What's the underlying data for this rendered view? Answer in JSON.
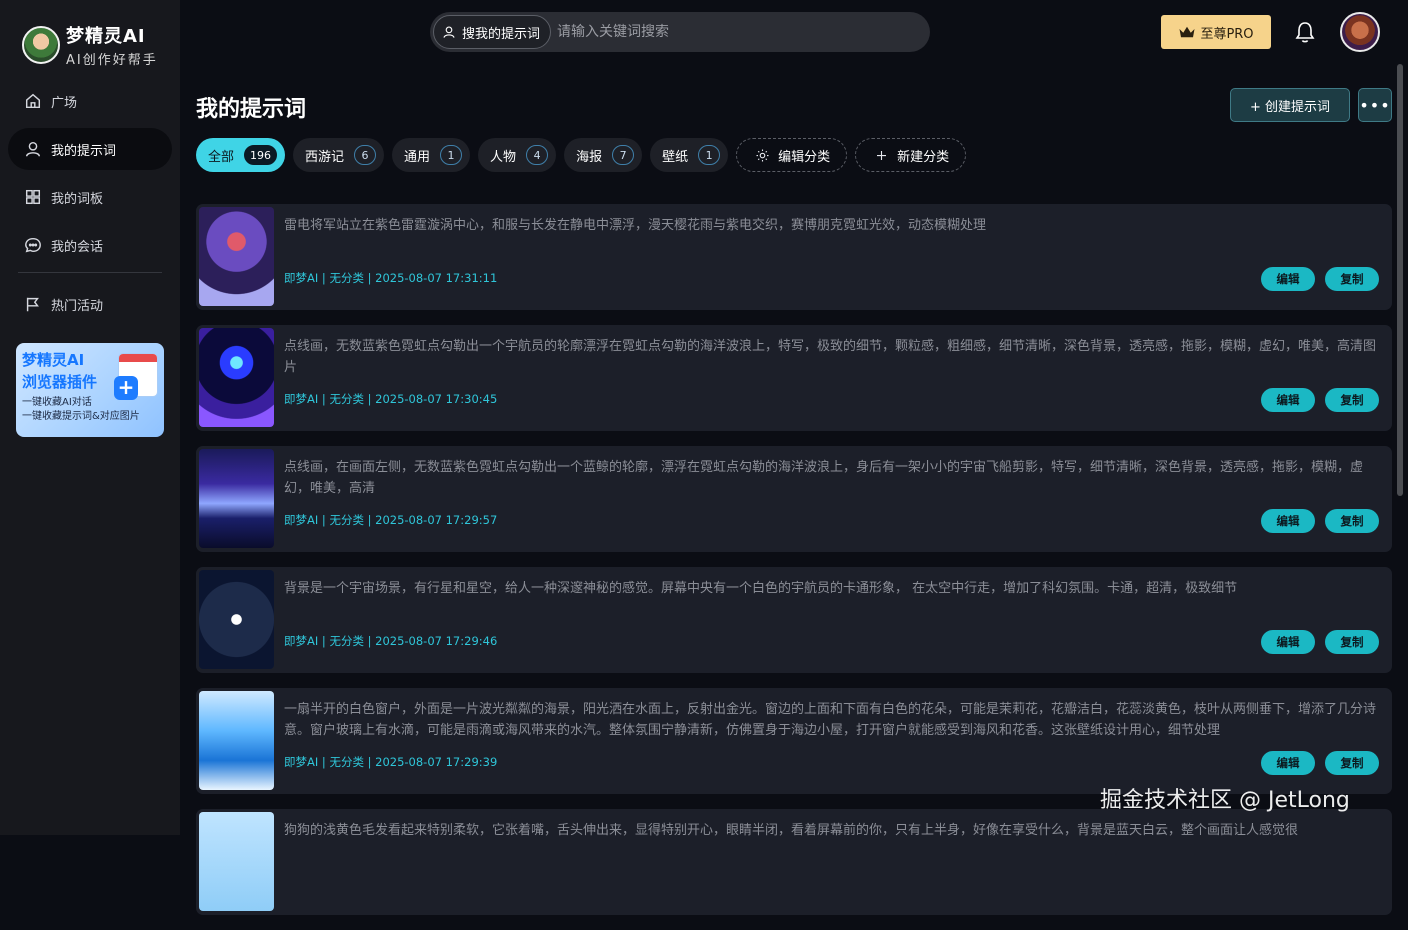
{
  "app": {
    "title": "梦精灵AI",
    "subtitle": "AI创作好帮手"
  },
  "sidebar": {
    "items": [
      {
        "label": "广场",
        "icon": "home-icon",
        "active": false
      },
      {
        "label": "我的提示词",
        "icon": "user-icon",
        "active": true
      },
      {
        "label": "我的词板",
        "icon": "grid-icon",
        "active": false
      },
      {
        "label": "我的会话",
        "icon": "chat-icon",
        "active": false
      },
      {
        "label": "热门活动",
        "icon": "flag-icon",
        "active": false
      }
    ],
    "promo": {
      "title1": "梦精灵AI",
      "title2": "浏览器插件",
      "line1": "一键收藏AI对话",
      "line2": "一键收藏提示词&对应图片"
    }
  },
  "search": {
    "scope_label": "搜我的提示词",
    "placeholder": "请输入关键词搜索",
    "value": ""
  },
  "header": {
    "pro_label": "至尊PRO",
    "pro_color": "#f6d38b"
  },
  "page": {
    "title": "我的提示词",
    "create_label": "+ 创建提示词",
    "more_label": "•••"
  },
  "tabs": [
    {
      "label": "全部",
      "count": "196",
      "active": true
    },
    {
      "label": "西游记",
      "count": "6",
      "active": false
    },
    {
      "label": "通用",
      "count": "1",
      "active": false
    },
    {
      "label": "人物",
      "count": "4",
      "active": false
    },
    {
      "label": "海报",
      "count": "7",
      "active": false
    },
    {
      "label": "壁纸",
      "count": "1",
      "active": false
    }
  ],
  "tab_actions": {
    "edit_category": "编辑分类",
    "new_category": "新建分类"
  },
  "card_actions": {
    "edit": "编辑",
    "copy": "复制"
  },
  "prompts": [
    {
      "text": "雷电将军站立在紫色雷霆漩涡中心，和服与长发在静电中漂浮，漫天樱花雨与紫电交织，赛博朋克霓虹光效，动态模糊处理",
      "meta": "即梦AI | 无分类 | 2025-08-07 17:31:11"
    },
    {
      "text": "点线画，无数蓝紫色霓虹点勾勒出一个宇航员的轮廓漂浮在霓虹点勾勒的海洋波浪上，特写，极致的细节，颗粒感，粗细感，细节清晰，深色背景，透亮感，拖影，模糊，虚幻，唯美，高清图片",
      "meta": "即梦AI | 无分类 | 2025-08-07 17:30:45"
    },
    {
      "text": "点线画，在画面左侧，无数蓝紫色霓虹点勾勒出一个蓝鲸的轮廓，漂浮在霓虹点勾勒的海洋波浪上，身后有一架小小的宇宙飞船剪影，特写，细节清晰，深色背景，透亮感，拖影，模糊，虚幻，唯美，高清",
      "meta": "即梦AI | 无分类 | 2025-08-07 17:29:57"
    },
    {
      "text": "背景是一个宇宙场景，有行星和星空，给人一种深邃神秘的感觉。屏幕中央有一个白色的宇航员的卡通形象， 在太空中行走，增加了科幻氛围。卡通，超清，极致细节",
      "meta": "即梦AI | 无分类 | 2025-08-07 17:29:46"
    },
    {
      "text": "一扇半开的白色窗户，外面是一片波光粼粼的海景，阳光洒在水面上，反射出金光。窗边的上面和下面有白色的花朵，可能是茉莉花，花瓣洁白，花蕊淡黄色，枝叶从两侧垂下，增添了几分诗意。窗户玻璃上有水滴，可能是雨滴或海风带来的水汽。整体氛围宁静清新，仿佛置身于海边小屋，打开窗户就能感受到海风和花香。这张壁纸设计用心，细节处理",
      "meta": "即梦AI | 无分类 | 2025-08-07 17:29:39"
    },
    {
      "text": "狗狗的浅黄色毛发看起来特别柔软，它张着嘴，舌头伸出来，显得特别开心，眼睛半闭，看着屏幕前的你，只有上半身，好像在享受什么，背景是蓝天白云，整个画面让人感觉很",
      "meta": ""
    }
  ],
  "watermark": "掘金技术社区 @ JetLong"
}
